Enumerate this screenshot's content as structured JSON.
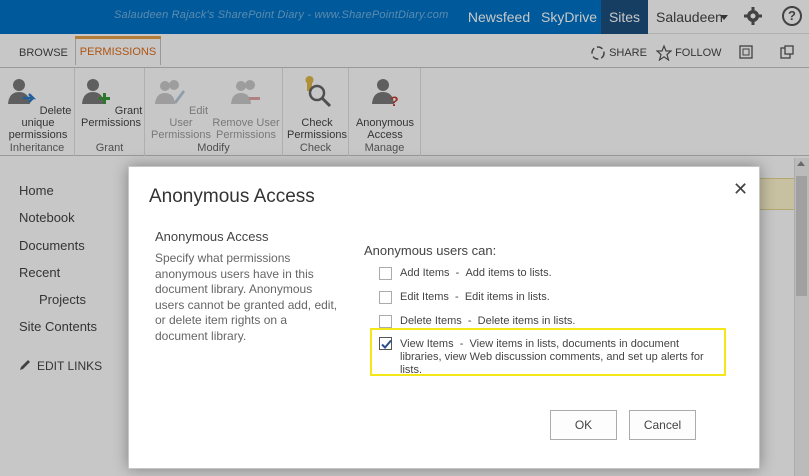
{
  "suite_bar": {
    "watermark": "Salaudeen Rajack's SharePoint Diary - www.SharePointDiary.com",
    "links": [
      "Newsfeed",
      "SkyDrive",
      "Sites"
    ],
    "user_name": "Salaudeen",
    "icons": [
      "gear-icon",
      "help-icon"
    ]
  },
  "tabs": {
    "browse": "BROWSE",
    "permissions": "PERMISSIONS",
    "share": "SHARE",
    "follow": "FOLLOW"
  },
  "ribbon": {
    "groups": [
      {
        "label": "Inheritance",
        "buttons": [
          {
            "label": "Delete unique permissions",
            "icon": "delete-unique-permissions-icon",
            "enabled": true
          }
        ]
      },
      {
        "label": "Grant",
        "buttons": [
          {
            "label": "Grant Permissions",
            "icon": "grant-permissions-icon",
            "enabled": true
          }
        ]
      },
      {
        "label": "Modify",
        "buttons": [
          {
            "label": "Edit User Permissions",
            "icon": "edit-user-permissions-icon",
            "enabled": false
          },
          {
            "label": "Remove User Permissions",
            "icon": "remove-user-permissions-icon",
            "enabled": false
          }
        ]
      },
      {
        "label": "Check",
        "buttons": [
          {
            "label": "Check Permissions",
            "icon": "check-permissions-icon",
            "enabled": true
          }
        ]
      },
      {
        "label": "Manage",
        "buttons": [
          {
            "label": "Anonymous Access",
            "icon": "anonymous-access-icon",
            "enabled": true
          }
        ]
      }
    ]
  },
  "nav": {
    "items": [
      "Home",
      "Notebook",
      "Documents",
      "Recent",
      "Projects",
      "Site Contents"
    ],
    "edit_links": "EDIT LINKS"
  },
  "dialog": {
    "title": "Anonymous Access",
    "section_title": "Anonymous Access",
    "section_description": "Specify what permissions anonymous users have in this document library. Anonymous users cannot be granted add, edit, or delete item rights on a document library.",
    "options_label": "Anonymous users can:",
    "options": [
      {
        "label": "Add Items",
        "description": "Add items to lists.",
        "checked": false
      },
      {
        "label": "Edit Items",
        "description": "Edit items in lists.",
        "checked": false
      },
      {
        "label": "Delete Items",
        "description": "Delete items in lists.",
        "checked": false
      },
      {
        "label": "View Items",
        "description": "View items in lists, documents in document libraries, view Web discussion comments, and set up alerts for lists.",
        "checked": true
      }
    ],
    "separator": "-",
    "ok_label": "OK",
    "cancel_label": "Cancel"
  },
  "colors": {
    "suite_bar": "#0072c6",
    "active_tab_text": "#e06d1b",
    "highlight_border": "#f3e71a"
  }
}
